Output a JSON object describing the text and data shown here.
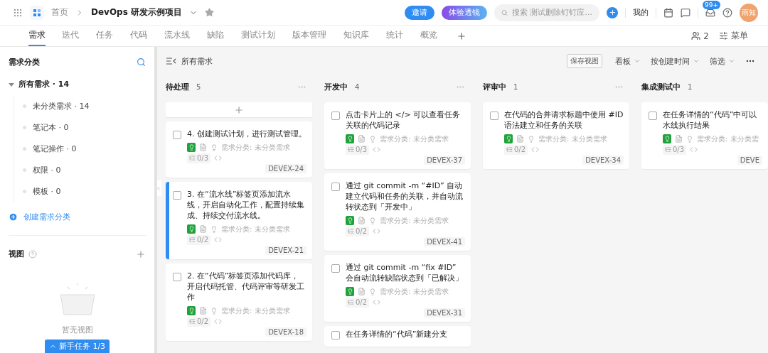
{
  "header": {
    "home": "首页",
    "project": "DevOps 研发示例项目",
    "invite": "邀请",
    "lens": "体验透镜",
    "search": {
      "placeholder": "搜索 测试删除钉钉应..."
    },
    "mine": "我的",
    "badge": "99+",
    "avatar": "雨知"
  },
  "nav": {
    "tabs": [
      {
        "label": "需求",
        "selected": true
      },
      {
        "label": "迭代",
        "selected": false
      },
      {
        "label": "任务",
        "selected": false
      },
      {
        "label": "代码",
        "selected": false
      },
      {
        "label": "流水线",
        "selected": false
      },
      {
        "label": "缺陷",
        "selected": false
      },
      {
        "label": "测试计划",
        "selected": false
      },
      {
        "label": "版本管理",
        "selected": false
      },
      {
        "label": "知识库",
        "selected": false
      },
      {
        "label": "统计",
        "selected": false
      },
      {
        "label": "概览",
        "selected": false
      }
    ],
    "members": "2",
    "menu": "菜单"
  },
  "sidebar": {
    "title": "需求分类",
    "tree": {
      "label": "所有需求 · 14",
      "expanded": true,
      "children": [
        {
          "label": "未分类需求 · 14"
        },
        {
          "label": "笔记本 · 0"
        },
        {
          "label": "笔记操作 · 0"
        },
        {
          "label": "权限 · 0"
        },
        {
          "label": "模板 · 0"
        }
      ]
    },
    "create": "创建需求分类",
    "views_title": "视图",
    "empty": "暂无视图",
    "guide": "新手任务 1/3"
  },
  "board": {
    "view_title": "所有需求",
    "save_view": "保存视图",
    "toolbar": [
      "看板",
      "按创建时间",
      "筛选"
    ],
    "columns": [
      {
        "name": "待处理",
        "count": "5",
        "menu": true,
        "add_button": true,
        "cards": [
          {
            "title": "4. 创建测试计划，进行测试管理。",
            "category": "需求分类: 未分类需求",
            "subtasks": "0/3",
            "id": "DEVEX-24",
            "selected": false
          },
          {
            "title": "3. 在“流水线”标签页添加流水线，开启自动化工作，配置持续集成、持续交付流水线。",
            "category": "需求分类: 未分类需求",
            "subtasks": "0/2",
            "id": "DEVEX-21",
            "selected": true
          },
          {
            "title": "2. 在“代码”标签页添加代码库，开启代码托管、代码评审等研发工作",
            "category": "需求分类: 未分类需求",
            "subtasks": "0/2",
            "id": "DEVEX-18",
            "selected": false
          }
        ]
      },
      {
        "name": "开发中",
        "count": "4",
        "menu": true,
        "add_button": false,
        "cards": [
          {
            "title": "点击卡片上的 </> 可以查看任务关联的代码记录",
            "category": "需求分类: 未分类需求",
            "subtasks": "0/3",
            "id": "DEVEX-37",
            "selected": false
          },
          {
            "title": "通过 git commit -m “#ID” 自动建立代码和任务的关联，并自动流转状态到「开发中」",
            "category": "需求分类: 未分类需求",
            "subtasks": "0/2",
            "id": "DEVEX-41",
            "selected": false
          },
          {
            "title": "通过 git commit -m “fix #ID” 会自动流转缺陷状态到「已解决」",
            "category": "需求分类: 未分类需求",
            "subtasks": "0/2",
            "id": "DEVEX-31",
            "selected": false
          },
          {
            "title": "在任务详情的“代码”新建分支",
            "selected": false
          }
        ]
      },
      {
        "name": "评审中",
        "count": "1",
        "menu": true,
        "add_button": false,
        "cards": [
          {
            "title": "在代码的合并请求标题中使用 #ID 语法建立和任务的关联",
            "category": "需求分类: 未分类需求",
            "subtasks": "0/2",
            "id": "DEVEX-34",
            "selected": false
          }
        ]
      },
      {
        "name": "集成测试中",
        "count": "1",
        "menu": false,
        "add_button": false,
        "cards": [
          {
            "lines": [
              "在任务详情的“代码”中可以",
              "水线执行结果"
            ],
            "category": "需求分类: 未分类需",
            "subtasks": "0/3",
            "id": "DEVE",
            "selected": false
          }
        ]
      }
    ]
  }
}
